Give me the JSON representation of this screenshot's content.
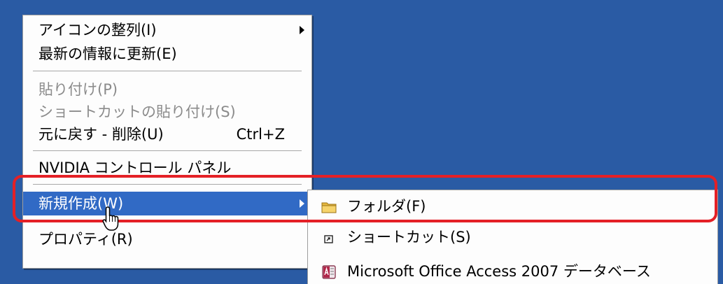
{
  "context_menu": {
    "items": [
      {
        "label": "アイコンの整列(I)",
        "has_submenu": true,
        "disabled": false
      },
      {
        "label": "最新の情報に更新(E)",
        "disabled": false
      },
      {
        "label": "貼り付け(P)",
        "disabled": true
      },
      {
        "label": "ショートカットの貼り付け(S)",
        "disabled": true
      },
      {
        "label": "元に戻す - 削除(U)",
        "shortcut": "Ctrl+Z",
        "disabled": false
      },
      {
        "label": "NVIDIA コントロール パネル",
        "disabled": false
      },
      {
        "label": "新規作成(W)",
        "has_submenu": true,
        "highlighted": true
      },
      {
        "label": "プロパティ(R)",
        "disabled": false
      }
    ]
  },
  "new_submenu": {
    "items": [
      {
        "label": "フォルダ(F)",
        "icon": "folder-icon"
      },
      {
        "label": "ショートカット(S)",
        "icon": "shortcut-icon"
      },
      {
        "label": "Microsoft Office Access 2007 データベース",
        "icon": "access-database-icon"
      }
    ]
  },
  "colors": {
    "desktop_background": "#2a5ba4",
    "menu_background": "#fdfdfd",
    "selection_highlight": "#316ac5",
    "annotation_red": "#e42026"
  }
}
